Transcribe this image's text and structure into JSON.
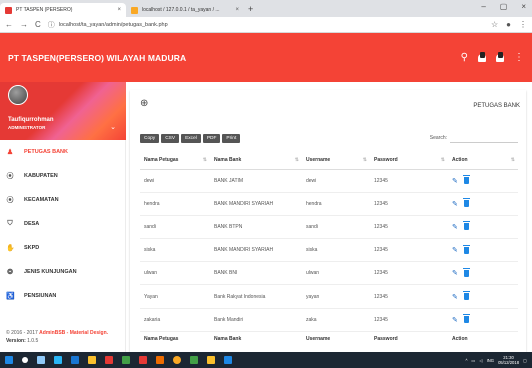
{
  "browser": {
    "tabs": [
      {
        "title": "PT TASPEN (PERSERO)",
        "close": "×"
      },
      {
        "title": "localhost / 127.0.0.1 / ta_yayan / ...",
        "close": "×"
      }
    ],
    "new_tab": "+",
    "window_controls": [
      "–",
      "▢",
      "×"
    ],
    "url": "localhost/ta_yayan/admin/petugas_bank.php",
    "colors": {
      "tab1_favicon": "#e53935",
      "tab2_favicon": "#f9a825"
    }
  },
  "header": {
    "brand": "PT TASPEN(PERSERO) WILAYAH MADURA",
    "color": "#f44336"
  },
  "user": {
    "name": "Taufiqurrohman",
    "role": "ADMINISTRATOR"
  },
  "sidebar": {
    "items": [
      {
        "label": "PETUGAS BANK",
        "icon": "person-icon",
        "glyph": "♟"
      },
      {
        "label": "KABUPATEN",
        "icon": "location-pin-icon",
        "glyph": "⦿"
      },
      {
        "label": "KECAMATAN",
        "icon": "location-pin-icon",
        "glyph": "⦿"
      },
      {
        "label": "DESA",
        "icon": "shield-icon",
        "glyph": "⛉"
      },
      {
        "label": "SKPD",
        "icon": "handshake-icon",
        "glyph": "✋"
      },
      {
        "label": "JENIS KUNJUNGAN",
        "icon": "group-icon",
        "glyph": "❂"
      },
      {
        "label": "PENSIUNAN",
        "icon": "walking-person-icon",
        "glyph": "♿"
      }
    ],
    "footer_prefix": "© 2016 - 2017",
    "footer_link": "AdminBSB - Material Design.",
    "version_label": "Version:",
    "version": "1.0.5"
  },
  "main": {
    "add_icon": "⊕",
    "title": "PETUGAS BANK",
    "buttons": [
      "Copy",
      "CSV",
      "Excel",
      "PDF",
      "Print"
    ],
    "search_label": "Search:",
    "columns": [
      "Nama Petugas",
      "Nama Bank",
      "Username",
      "Password",
      "Action"
    ],
    "rows": [
      [
        "dewi",
        "BANK JATIM",
        "dewi",
        "12345"
      ],
      [
        "hendra",
        "BANK MANDIRI SYARIAH",
        "hendra",
        "12345"
      ],
      [
        "sandi",
        "BANK BTPN",
        "sandi",
        "12345"
      ],
      [
        "siska",
        "BANK MANDIRI SYARIAH",
        "siska",
        "12345"
      ],
      [
        "ulwan",
        "BANK BNI",
        "ulwan",
        "12345"
      ],
      [
        "Yayan",
        "Bank Rakyat Indonesia",
        "yayan",
        "12345"
      ],
      [
        "zakaria",
        "Bank Mandiri",
        "zaka",
        "12345"
      ]
    ]
  },
  "taskbar": {
    "apps": [
      "#1e88e5",
      "#ffffff",
      "#90caf9",
      "#29b6f6",
      "#1976d2",
      "#fbc02d",
      "#e53935",
      "#43a047",
      "#e53935",
      "#ef6c00",
      "#f9a825",
      "#43a047",
      "#fbc02d",
      "#1e88e5"
    ],
    "lang": "ING",
    "time": "21:30",
    "date": "05/12/2018"
  }
}
